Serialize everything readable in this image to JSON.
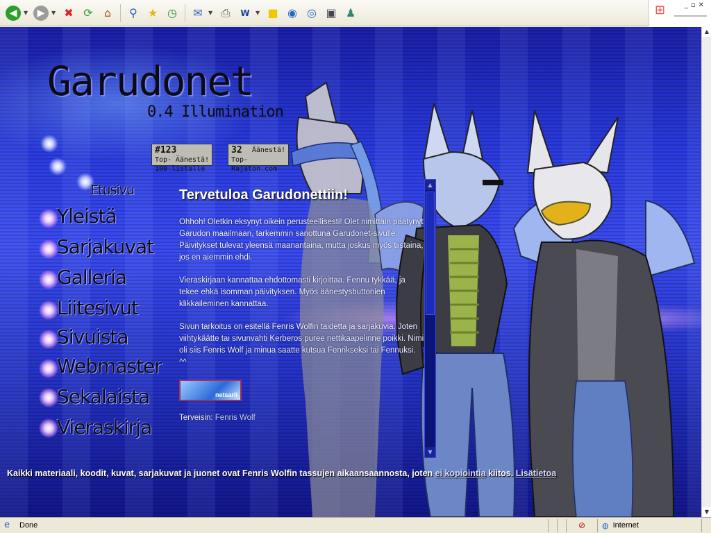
{
  "toolbar": {
    "back_icon": "back-arrow-icon",
    "forward_icon": "forward-arrow-icon",
    "buttons": [
      "stop",
      "refresh",
      "home",
      "search",
      "favorites",
      "history",
      "mail",
      "print",
      "edit",
      "note",
      "messenger1",
      "messenger2",
      "research",
      "contacts"
    ]
  },
  "site": {
    "logo": "Garudonet",
    "version": "0.4 Illumination"
  },
  "votes": [
    {
      "rank": "#123",
      "label": "Äänestä!",
      "site": "Top-100 listalle"
    },
    {
      "rank": "32",
      "label": "Äänestä!",
      "site": "Top-Rajaton.com"
    }
  ],
  "nav": {
    "home": "Etusivu",
    "items": [
      "Yleistä",
      "Sarjakuvat",
      "Galleria",
      "Liitesivut",
      "Sivuista",
      "Webmaster",
      "Sekalaista",
      "Vieraskirja"
    ]
  },
  "content": {
    "heading": "Tervetuloa Garudonettiin!",
    "paragraphs": [
      "Ohhoh! Oletkin eksynyt oikein perusteellisesti! Olet nimittäin päätynyt Garudon maailmaan, tarkemmin sanottuna Garudonet-sivulle. Päivitykset tulevat yleensä maanantaina, mutta joskus myös tiistaina, jos en aiemmin ehdi.",
      "Vieraskirjaan kannattaa ehdottomasti kirjoittaa. Fennu tykkää, ja tekee ehkä isomman päivityksen. Myös äänestysbuttonien klikkaileminen kannattaa.",
      "Sivun tarkoitus on esitellä Fenris Wolfin taidetta ja sarjakuvia. Joten viihtykäätte tai sivunvahti Kerberos puree nettikaapelinne poikki. Nimi oli siis Fenris Wolf ja minua saatte kutsua Fenrikseksi tai Fennuksi. ^^"
    ],
    "banner": "netsarli",
    "signature_prefix": "Terveisin:",
    "signature_name": "Fenris Wolf"
  },
  "footer": {
    "text_before": "Kaikki materiaali, koodit, kuvat, sarjakuvat ja juonet ovat Fenris Wolfin tassujen aikaansaannosta, joten",
    "link1": "ei kopiointia",
    "text_after": "kiitos.",
    "link2": "Lisätietoa"
  },
  "statusbar": {
    "status": "Done",
    "zone": "Internet"
  },
  "colors": {
    "page_bg": "#2a3ce0",
    "toolbar_bg": "#ece9d8",
    "nav_text": "#0a0a18"
  }
}
